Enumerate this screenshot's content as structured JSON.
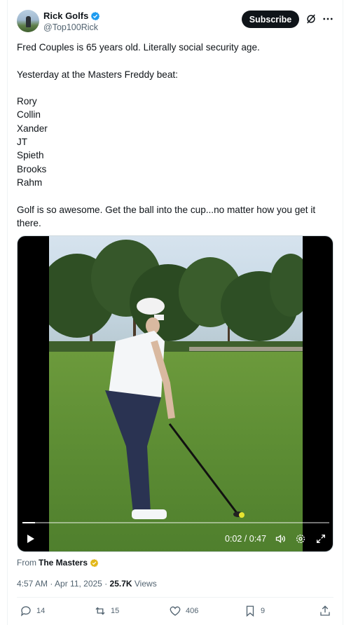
{
  "author": {
    "name": "Rick Golfs",
    "handle": "@Top100Rick"
  },
  "header": {
    "subscribe_label": "Subscribe"
  },
  "tweet": {
    "lines": [
      "Fred Couples is 65 years old. Literally social security age.",
      "",
      "Yesterday at the Masters Freddy beat:",
      "",
      "Rory",
      "Collin",
      "Xander",
      "JT",
      "Spieth",
      "Brooks",
      "Rahm",
      "",
      "Golf is so awesome. Get the ball into the cup...no matter how you get it",
      "there."
    ]
  },
  "video": {
    "time": "0:02 / 0:47",
    "progress": 0.04
  },
  "source": {
    "prefix": "From",
    "name": "The Masters"
  },
  "meta": {
    "timestamp": "4:57 AM · Apr 11, 2025 · ",
    "views_count": "25.7K",
    "views_label": " Views"
  },
  "actions": {
    "replies": "14",
    "reposts": "15",
    "likes": "406",
    "bookmarks": "9"
  },
  "colors": {
    "verified_blue": "#1d9bf0",
    "verified_gold": "#e2b719",
    "text_secondary": "#536471"
  }
}
